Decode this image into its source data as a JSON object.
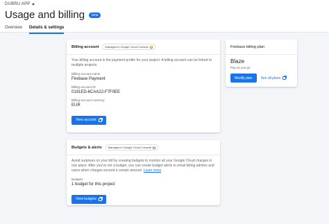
{
  "app": {
    "name": "DUBRU APP"
  },
  "page": {
    "title": "Usage and billing",
    "badge": "Beta"
  },
  "tabs": [
    {
      "label": "Overview",
      "active": false
    },
    {
      "label": "Details & settings",
      "active": true
    }
  ],
  "billing_account": {
    "title": "Billing account",
    "managed": "Managed in Google Cloud Console",
    "description": "Your billing account is the payment profile for your project. A billing account can be linked to multiple projects.",
    "name_label": "Billing account name",
    "name_value": "Firebase Payment",
    "id_label": "Billing account ID",
    "id_value": "0191ED-6CAA22-F7F0EE",
    "currency_label": "Billing account currency",
    "currency_value": "EUR",
    "button": "View account"
  },
  "budgets": {
    "title": "Budgets & alerts",
    "managed": "Managed in Google Cloud Console",
    "description": "Avoid surprises on your bill by creating budgets to monitor all your Google Cloud charges in one place. After you've set a budget, you can create budget alerts to email billing admins and users when charges exceed a certain amount.",
    "learn_more": "Learn more",
    "budgets_label": "Budgets",
    "budgets_value": "1 budget for this project",
    "button": "View budgets"
  },
  "plan": {
    "title": "Firebase billing plan",
    "name": "Blaze",
    "subtitle": "Pay as you go",
    "modify_button": "Modify plan",
    "see_plans": "See all plans"
  },
  "colors": {
    "accent": "#1a73e8",
    "background": "#f3f5f8"
  }
}
